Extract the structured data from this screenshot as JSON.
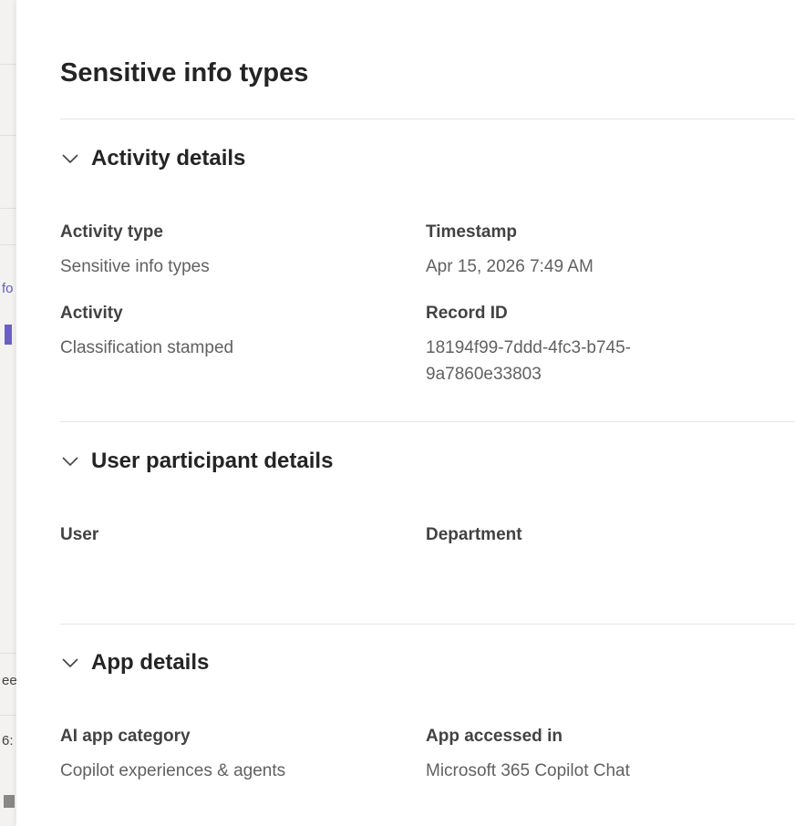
{
  "panel": {
    "title": "Sensitive info types"
  },
  "sections": {
    "activity": {
      "title": "Activity details",
      "fields": {
        "activity_type_label": "Activity type",
        "activity_type_value": "Sensitive info types",
        "timestamp_label": "Timestamp",
        "timestamp_value": "Apr 15, 2026 7:49 AM",
        "activity_label": "Activity",
        "activity_value": "Classification stamped",
        "record_id_label": "Record ID",
        "record_id_value": "18194f99-7ddd-4fc3-b745-9a7860e33803"
      }
    },
    "user": {
      "title": "User participant details",
      "fields": {
        "user_label": "User",
        "department_label": "Department"
      }
    },
    "app": {
      "title": "App details",
      "fields": {
        "ai_app_category_label": "AI app category",
        "ai_app_category_value": "Copilot experiences & agents",
        "app_accessed_label": "App accessed in",
        "app_accessed_value": "Microsoft 365 Copilot Chat"
      }
    }
  },
  "background": {
    "fragments": [
      "fo",
      "ee",
      "6:"
    ]
  },
  "icons": {
    "section_toggle": "chevron-down-icon"
  },
  "colors": {
    "accent": "#5b5fc7",
    "text_primary": "#242424",
    "text_secondary": "#616161",
    "divider": "#e6e6e6"
  }
}
